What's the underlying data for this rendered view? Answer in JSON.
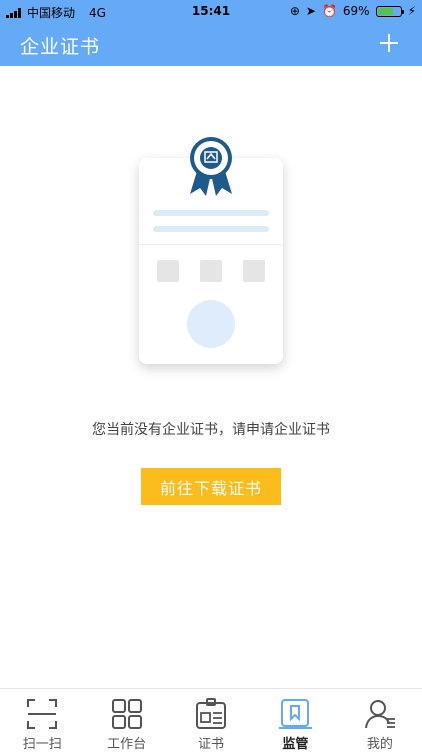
{
  "status_bar": {
    "carrier": "中国移动",
    "network": "4G",
    "time": "15:41",
    "battery_percent": "69%",
    "battery_level": 0.69,
    "battery_color": "#55c24f"
  },
  "header": {
    "title": "企业证书",
    "add_icon": "plus-icon"
  },
  "main": {
    "empty_message": "您当前没有企业证书，请申请企业证书",
    "download_button": "前往下载证书"
  },
  "tabs": [
    {
      "label": "扫一扫",
      "icon": "scan-icon",
      "active": false
    },
    {
      "label": "工作台",
      "icon": "grid-icon",
      "active": false
    },
    {
      "label": "证书",
      "icon": "certificate-icon",
      "active": false
    },
    {
      "label": "监管",
      "icon": "bookmark-icon",
      "active": true
    },
    {
      "label": "我的",
      "icon": "user-icon",
      "active": false
    }
  ],
  "colors": {
    "primary": "#64aaf6",
    "button": "#fbbc1c",
    "badge": "#1e5a8c"
  }
}
